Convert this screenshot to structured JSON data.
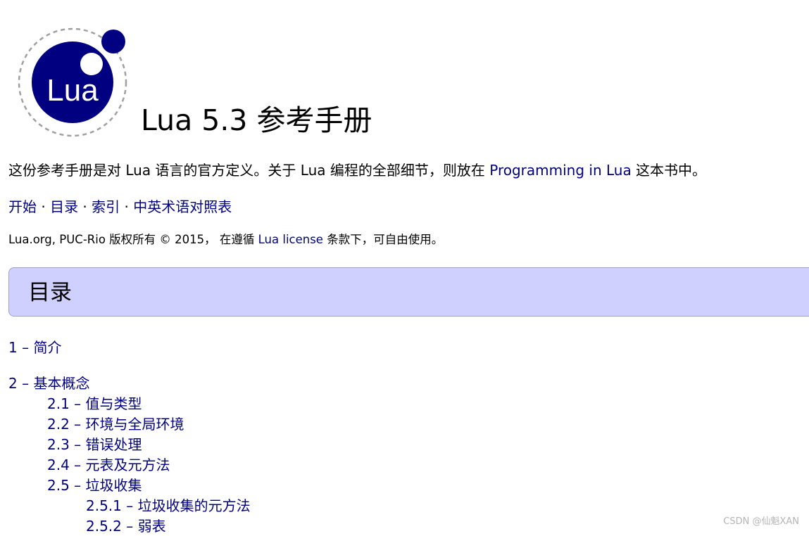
{
  "logo": {
    "text": "Lua"
  },
  "title": "Lua 5.3 参考手册",
  "intro": {
    "before": "这份参考手册是对 Lua 语言的官方定义。关于 Lua 编程的全部细节，则放在 ",
    "link": "Programming in Lua",
    "after": " 这本书中。"
  },
  "nav": {
    "start": "开始",
    "contents": "目录",
    "index": "索引",
    "glossary": "中英术语对照表",
    "separator": " · "
  },
  "copyright": {
    "before": "Lua.org, PUC-Rio 版权所有 © 2015， 在遵循 ",
    "link": "Lua license",
    "after": " 条款下，可自由使用。"
  },
  "toc_title": "目录",
  "toc": [
    {
      "label": "1 – 简介",
      "level": 1
    },
    {
      "label": "2 – 基本概念",
      "level": 1
    },
    {
      "label": "2.1 – 值与类型",
      "level": 2
    },
    {
      "label": "2.2 – 环境与全局环境",
      "level": 2
    },
    {
      "label": "2.3 – 错误处理",
      "level": 2
    },
    {
      "label": "2.4 – 元表及元方法",
      "level": 2
    },
    {
      "label": "2.5 – 垃圾收集",
      "level": 2
    },
    {
      "label": "2.5.1 – 垃圾收集的元方法",
      "level": 3
    },
    {
      "label": "2.5.2 – 弱表",
      "level": 3
    }
  ],
  "watermark": "CSDN @仙魁XAN",
  "colors": {
    "link": "#000080",
    "toc_header_bg": "#d0d0ff",
    "logo": "#000080"
  }
}
